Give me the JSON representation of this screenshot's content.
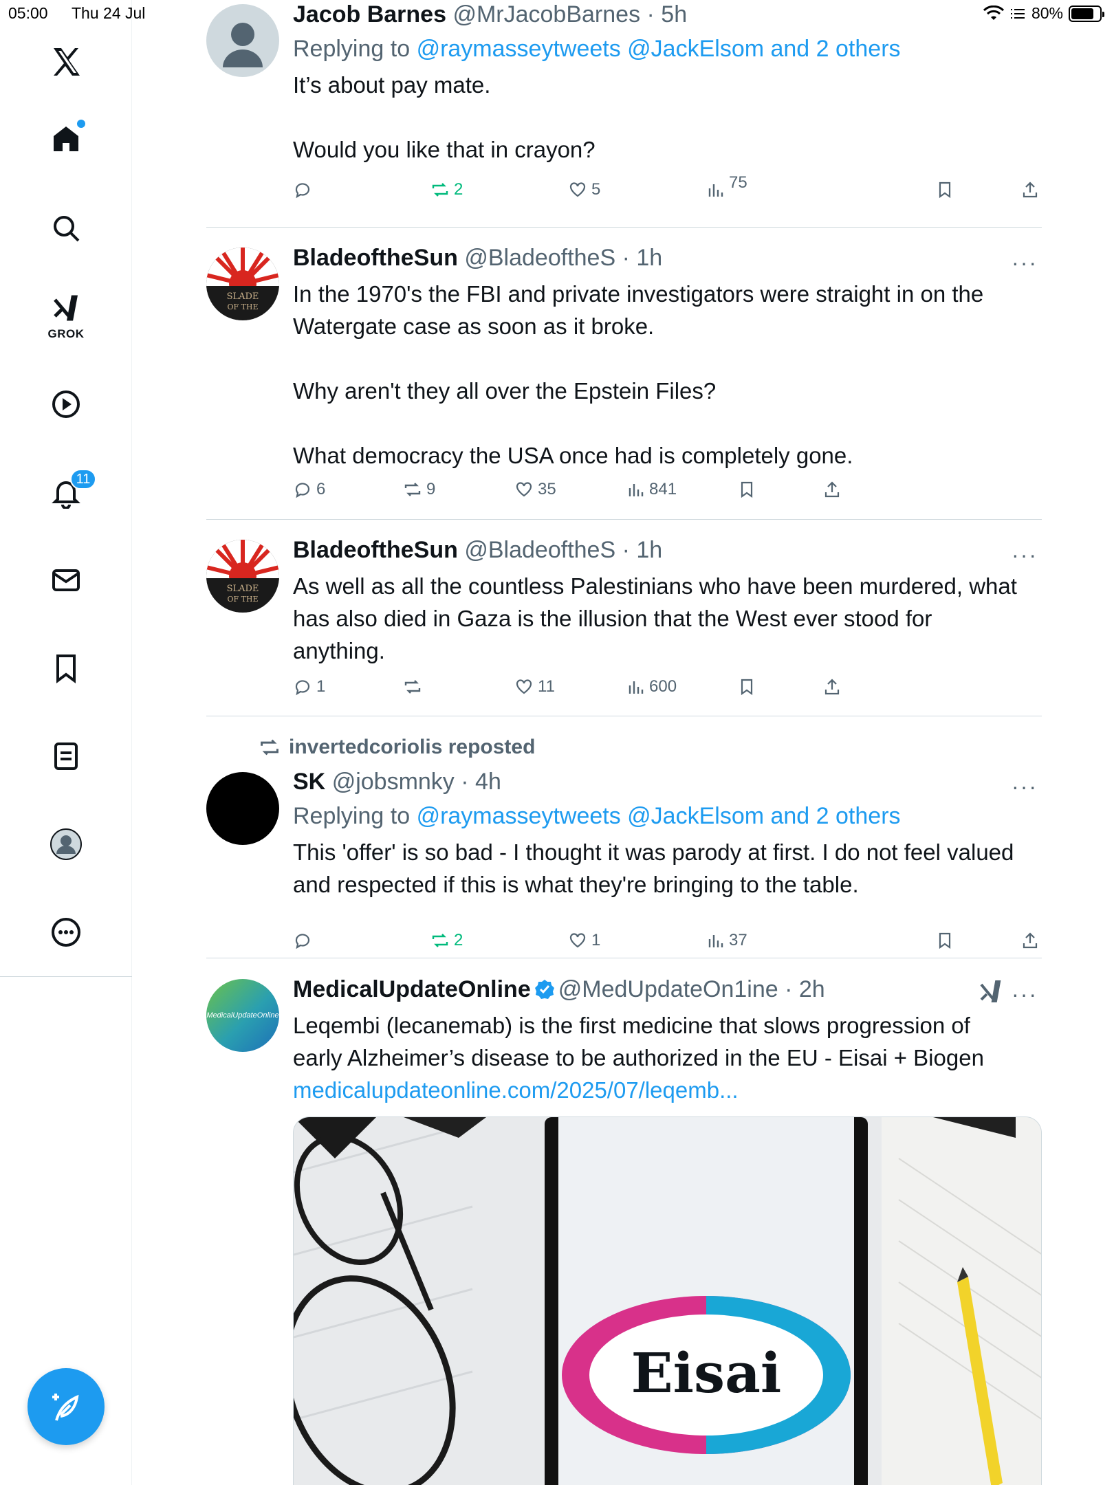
{
  "status_bar": {
    "time": "05:00",
    "date": "Thu 24 Jul",
    "battery": "80%"
  },
  "sidebar": {
    "grok_label": "GROK",
    "notifications_count": "11",
    "items": [
      "home-icon",
      "search-icon",
      "grok-icon",
      "video-icon",
      "notifications-icon",
      "messages-icon",
      "bookmarks-icon",
      "lists-icon",
      "profile-icon",
      "more-icon"
    ]
  },
  "colors": {
    "accent": "#1d9bf0",
    "repost_active": "#00ba7c",
    "muted": "#536471"
  },
  "tweets": [
    {
      "name": "Jacob Barnes",
      "handle": "@MrJacobBarnes",
      "time": "5h",
      "replying_label": "Replying to",
      "replying_to": "@raymasseytweets @JackElsom and 2 others",
      "lines": [
        "It’s about pay mate.",
        "",
        "Would you like that in crayon?"
      ],
      "replies": "",
      "reposts": "2",
      "likes": "5",
      "views": "75"
    },
    {
      "name": "BladeoftheSun",
      "handle": "@BladeoftheS",
      "time": "1h",
      "lines": [
        "In the 1970's the FBI and private investigators were straight in on the",
        "Watergate case as soon as it broke.",
        "",
        "Why aren't they all over the Epstein Files?",
        "",
        "What democracy the USA once had is completely gone."
      ],
      "replies": "6",
      "reposts": "9",
      "likes": "35",
      "views": "841"
    },
    {
      "name": "BladeoftheSun",
      "handle": "@BladeoftheS",
      "time": "1h",
      "lines": [
        "As well as all the countless Palestinians who have been murdered, what",
        "has also died in Gaza is the illusion that the West ever stood for",
        "anything."
      ],
      "replies": "1",
      "reposts": "",
      "likes": "11",
      "views": "600"
    },
    {
      "repost_by": "invertedcoriolis reposted",
      "name": "SK",
      "handle": "@jobsmnky",
      "time": "4h",
      "replying_label": "Replying to",
      "replying_to": "@raymasseytweets @JackElsom and 2 others",
      "lines": [
        "This 'offer' is so bad - I thought it was parody at first. I do not feel valued",
        "and respected if this is what they're bringing to the table."
      ],
      "replies": "",
      "reposts": "2",
      "likes": "1",
      "views": "37"
    },
    {
      "name": "MedicalUpdateOnline",
      "handle": "@MedUpdateOn1ine",
      "time": "2h",
      "avatar_text": "MedicalUpdateOnline",
      "lines": [
        "Leqembi (lecanemab) is the first medicine that slows progression of",
        "early Alzheimer’s disease to be authorized in the EU - Eisai + Biogen"
      ],
      "link": "medicalupdateonline.com/2025/07/leqemb...",
      "media_logo": "Eisai"
    }
  ]
}
